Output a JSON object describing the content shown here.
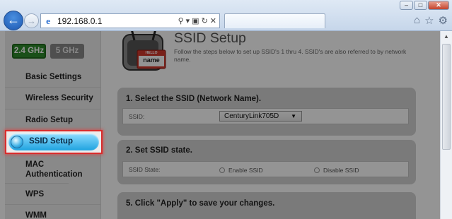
{
  "browser": {
    "address": "192.168.0.1",
    "window_buttons": [
      "–",
      "□",
      "✕"
    ],
    "toolbar_icons": [
      "home-icon",
      "favorites-star-icon",
      "tools-gear-icon"
    ]
  },
  "sidebar": {
    "bands": [
      "2.4 GHz",
      "5 GHz"
    ],
    "items": [
      "Basic Settings",
      "Wireless Security",
      "Radio Setup",
      "SSID Setup",
      "MAC Authentication",
      "WPS",
      "WMM"
    ]
  },
  "page": {
    "title": "SSID Setup",
    "description": "Follow the steps below to set up SSID's 1 thru 4. SSID's are also referred to by network name.",
    "router_badge_top": "HELLO",
    "router_badge_bottom": "name"
  },
  "sections": [
    {
      "heading": "1. Select the SSID (Network Name).",
      "row_label": "SSID:",
      "select_value": "CenturyLink705D"
    },
    {
      "heading": "2. Set SSID state.",
      "row_label": "SSID State:",
      "options": [
        "Enable SSID",
        "Disable SSID"
      ]
    },
    {
      "heading": "5. Click \"Apply\" to save your changes."
    }
  ],
  "colors": {
    "highlight_border": "#d92c2c",
    "band_active": "#2e8a2b",
    "selected_button": "#1fa3e0"
  }
}
